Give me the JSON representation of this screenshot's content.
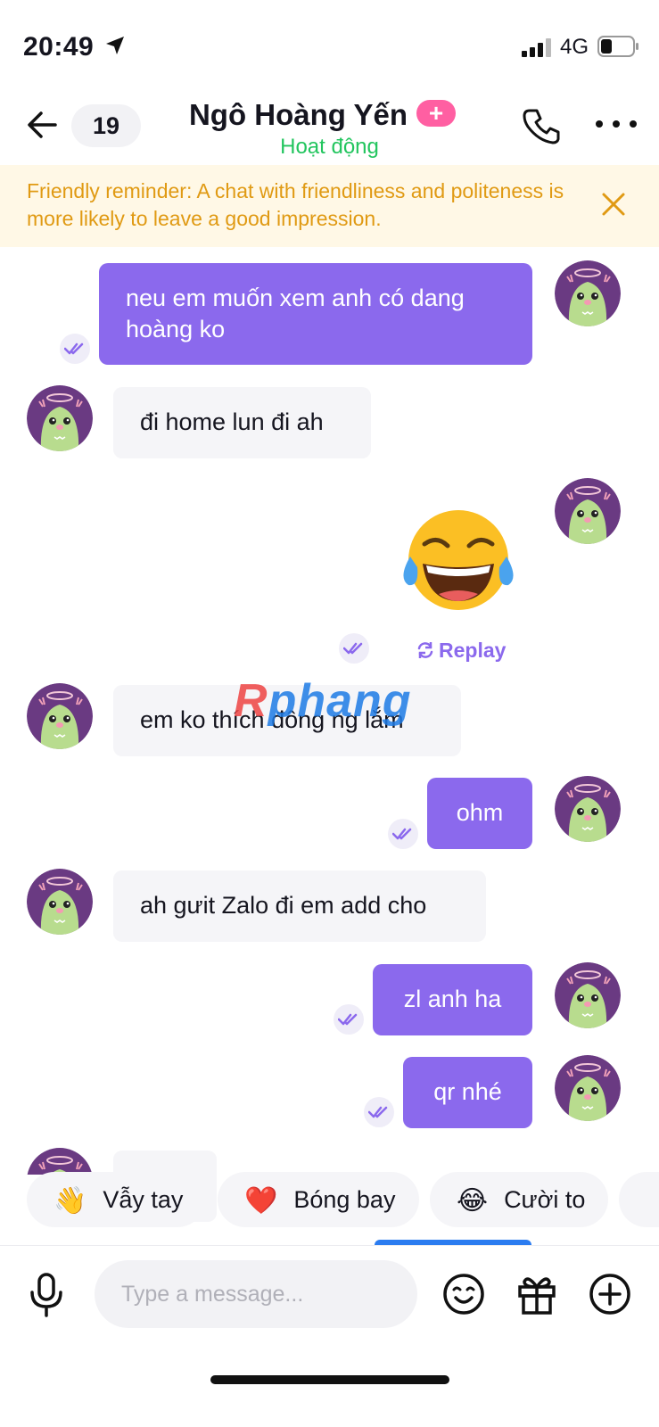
{
  "status_bar": {
    "time": "20:49",
    "network": "4G"
  },
  "header": {
    "unread_count": "19",
    "contact_name": "Ngô Hoàng Yến",
    "plus_badge": "+",
    "status": "Hoạt động"
  },
  "reminder": {
    "text": "Friendly reminder: A chat with friendliness and politeness is more likely to leave a good impression."
  },
  "messages": [
    {
      "direction": "out",
      "text": "neu em muốn xem anh có dang hoàng ko"
    },
    {
      "direction": "in",
      "text": "đi home lun đi ah"
    },
    {
      "direction": "out",
      "type": "emoji",
      "emoji": "😂",
      "action": "Replay"
    },
    {
      "direction": "in",
      "text": "em ko thích đông ng lắm"
    },
    {
      "direction": "out",
      "text": "ohm"
    },
    {
      "direction": "in",
      "text": "ah gưit Zalo đi em add cho"
    },
    {
      "direction": "out",
      "text": "zl anh ha"
    },
    {
      "direction": "out",
      "text": "qr nhé"
    }
  ],
  "watermark": {
    "part1": "R",
    "part2": "phang"
  },
  "quick_reactions": [
    {
      "emoji": "👋",
      "label": "Vẫy tay"
    },
    {
      "emoji": "❤️",
      "label": "Bóng bay"
    },
    {
      "emoji": "😂",
      "label": "Cười to"
    }
  ],
  "composer": {
    "placeholder": "Type a message..."
  },
  "colors": {
    "accent": "#8b69ed",
    "online": "#22c55e",
    "reminder_text": "#e09a13",
    "reminder_bg": "#fff8e6",
    "plus_badge": "#ff5fa2"
  },
  "icons": [
    "back-arrow-icon",
    "phone-icon",
    "more-dots-icon",
    "close-icon",
    "double-check-icon",
    "replay-icon",
    "mic-icon",
    "emoji-icon",
    "gift-icon",
    "plus-circle-icon"
  ]
}
